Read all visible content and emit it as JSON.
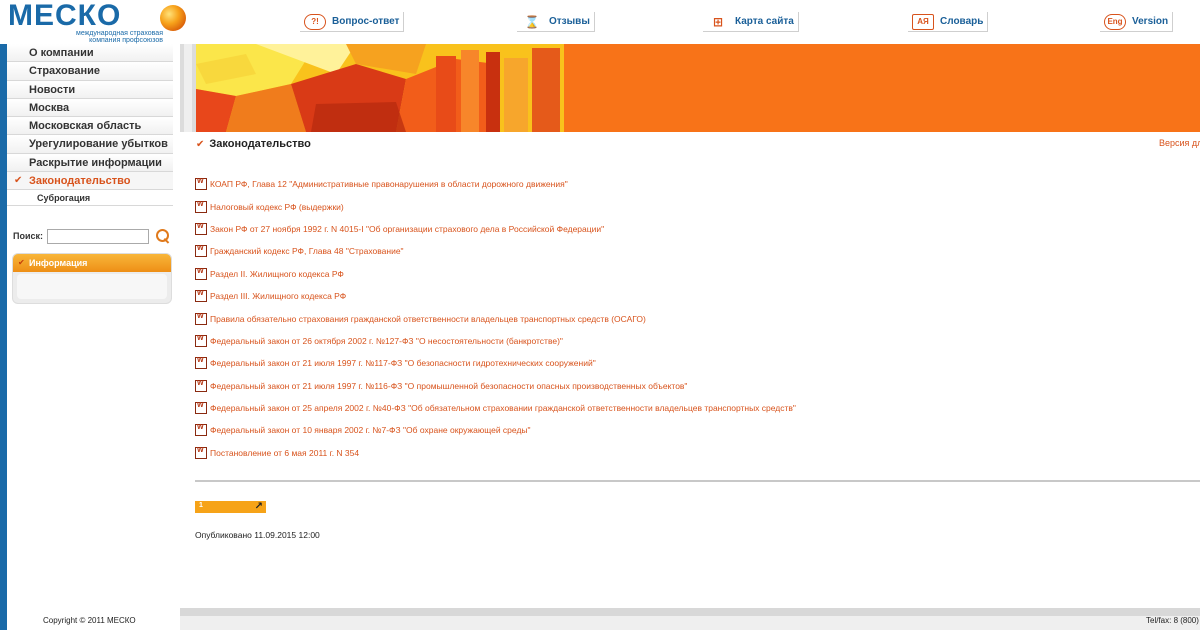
{
  "logo": {
    "word": "МЕСКО",
    "subtitle": "международная страховая компания профсоюзов"
  },
  "topnav": [
    {
      "icon": "?!",
      "label": "Вопрос-ответ"
    },
    {
      "icon": "⌛",
      "label": "Отзывы"
    },
    {
      "icon": "⊞",
      "label": "Карта сайта"
    },
    {
      "icon": "АЯ",
      "label": "Словарь"
    },
    {
      "icon": "Eng",
      "label": "Version"
    }
  ],
  "sidebar": {
    "items": [
      {
        "label": "О компании"
      },
      {
        "label": "Страхование"
      },
      {
        "label": "Новости"
      },
      {
        "label": "Москва"
      },
      {
        "label": "Московская область"
      },
      {
        "label": "Урегулирование убытков"
      },
      {
        "label": "Раскрытие информации"
      },
      {
        "label": "Законодательство",
        "active": true
      }
    ],
    "subitem": "Суброгация"
  },
  "search": {
    "label": "Поиск:",
    "value": ""
  },
  "info_box": {
    "title": "Информация"
  },
  "content": {
    "title": "Законодательство",
    "version_link": "Версия дл",
    "documents": [
      "КОАП РФ, Глава 12 \"Административные правонарушения в области дорожного движения\"",
      "Налоговый кодекс РФ (выдержки)",
      "Закон РФ от 27 ноября 1992 г. N 4015-I \"Об организации страхового дела в Российской Федерации\"",
      "Гражданский кодекс РФ, Глава 48 \"Страхование\"",
      "Раздел II.  Жилищного кодекса РФ",
      "Раздел III.  Жилищного кодекса РФ",
      "Правила обязательно страхования гражданской ответственности владельцев транспортных средств (ОСАГО)",
      "Федеральный закон от 26 октября 2002 г. №127-ФЗ \"О несостоятельности (банкротстве)\"",
      "Федеральный закон от 21 июля 1997 г. №117-ФЗ \"О безопасности гидротехнических сооружений\"",
      "Федеральный закон от 21 июля 1997 г. №116-ФЗ \"О промышленной безопасности опасных производственных объектов\"",
      "Федеральный закон от 25 апреля 2002 г. №40-ФЗ \"Об обязательном страховании гражданской ответственности владельцев транспортных средств\"",
      "Федеральный закон от 10 января 2002 г. №7-ФЗ \"Об охране окружающей среды\"",
      "Постановление от 6 мая 2011 г. N 354"
    ],
    "pager": {
      "page": "1",
      "arrow": "↗"
    },
    "published": "Опубликовано 11.09.2015 12:00"
  },
  "footer": {
    "copyright": "Copyright © 2011 МЕСКО",
    "tel": "Tel/fax: 8 (800)"
  },
  "colors": {
    "accent": "#d8531c",
    "brand_blue": "#1a6aa8",
    "banner_orange": "#f87318",
    "pager_orange": "#f6a318"
  }
}
